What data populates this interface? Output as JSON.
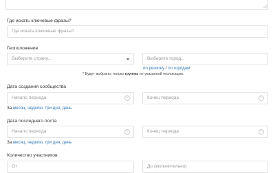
{
  "keywords_section": {
    "label": "Где искать ключевые фразы?",
    "placeholder": "Где искать ключевые фразы?"
  },
  "location_section": {
    "label": "Геоположение",
    "country_placeholder": "Выберите страну...",
    "city_placeholder": "Выберите город...",
    "by_region": "по региону",
    "separator": "/",
    "by_cities": "по городам",
    "note_prefix": "* Будут выбраны только",
    "note_bold": "группы",
    "note_suffix": "по указанной геолокации."
  },
  "creation_date_section": {
    "label": "Дата создания сообщества",
    "start_placeholder": "Начало периода",
    "end_placeholder": "Конец периода",
    "quick_prefix": "За",
    "month": "месяц,",
    "week": "неделю,",
    "three_days": "три дня,",
    "day": "день"
  },
  "last_post_section": {
    "label": "Дата последнего поста",
    "start_placeholder": "Начало периода",
    "end_placeholder": "Конец периода",
    "quick_prefix": "За",
    "month": "месяц,",
    "week": "неделю,",
    "three_days": "три дня,",
    "day": "день"
  },
  "members_section": {
    "label": "Количество участников",
    "from_placeholder": "От",
    "to_placeholder": "До (включительно)"
  },
  "colors": {
    "link": "#2f77b7",
    "border": "#e3e3e3",
    "placeholder": "#9a9a9a"
  }
}
